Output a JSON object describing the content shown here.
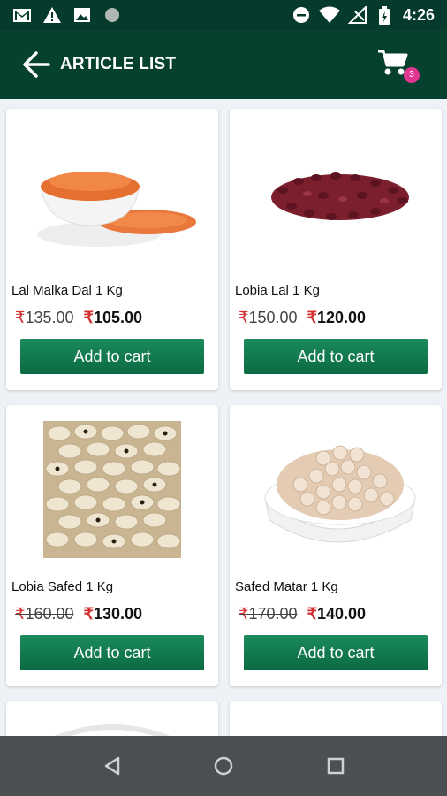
{
  "status_bar": {
    "time": "4:26"
  },
  "app_bar": {
    "title": "ARTICLE LIST",
    "cart_count": "3"
  },
  "products": [
    {
      "name": "Lal Malka Dal 1 Kg",
      "old_price": "135.00",
      "new_price": "105.00",
      "button": "Add to cart",
      "image": "red-lentils-bowl-image"
    },
    {
      "name": "Lobia Lal 1 Kg",
      "old_price": "150.00",
      "new_price": "120.00",
      "button": "Add to cart",
      "image": "red-kidney-beans-image"
    },
    {
      "name": "Lobia Safed 1 Kg",
      "old_price": "160.00",
      "new_price": "130.00",
      "button": "Add to cart",
      "image": "black-eyed-peas-image"
    },
    {
      "name": "Safed Matar 1 Kg",
      "old_price": "170.00",
      "new_price": "140.00",
      "button": "Add to cart",
      "image": "white-peas-bowl-image"
    }
  ],
  "currency_symbol": "₹",
  "colors": {
    "primary": "#06402f",
    "button": "#0c6a43",
    "badge": "#e0368f",
    "rupee": "#d32f2f"
  }
}
